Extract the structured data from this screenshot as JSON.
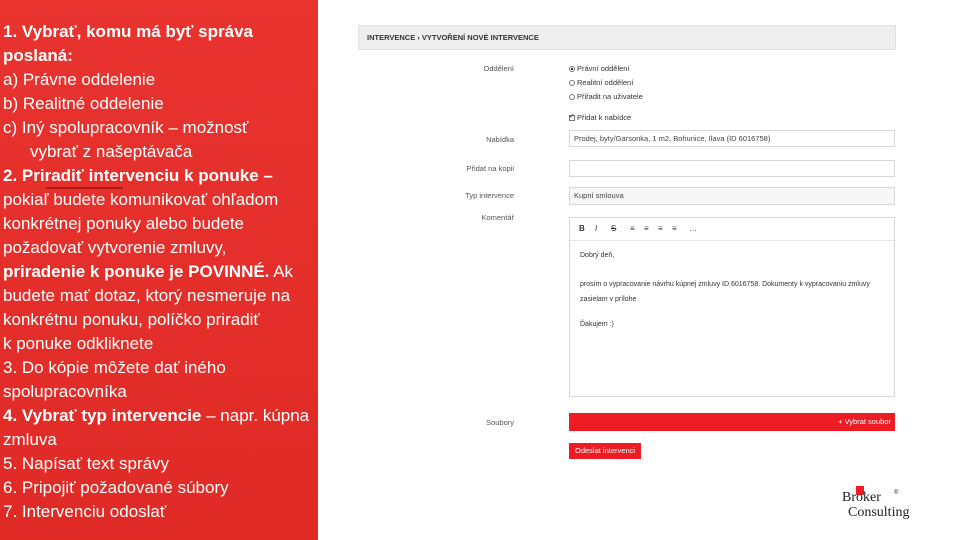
{
  "instructions": {
    "lines": [
      "1. Vybrať, komu má byť správa",
      "poslaná:",
      "a)  Právne oddelenie",
      "b)  Realitné oddelenie",
      "c)  Iný spolupracovník – možnosť",
      "vybrať z našeptávača",
      "2. Priradiť intervenciu k ponuke –",
      "pokiaľ budete komunikovať ohľadom",
      "konkrétnej ponuky alebo budete",
      "požadovať vytvorenie zmluvy,",
      "priradenie k ponuke je POVINNÉ.",
      "Ak",
      "budete mať dotaz, ktorý nesmeruje na",
      "konkrétnu ponuku, políčko priradiť",
      "k ponuke odkliknete",
      "3. Do kópie môžete dať iného",
      "spolupracovníka",
      "4. Vybrať typ intervencie",
      "– napr. kúpna",
      "zmluva",
      "5. Napísať text správy",
      "6. Pripojiť požadované súbory",
      "7. Intervenciu odoslať"
    ]
  },
  "form": {
    "breadcrumb": "INTERVENCE › VYTVOŘENÍ NOVÉ INTERVENCE",
    "labels": {
      "oddeleni": "Oddělení",
      "nabidka": "Nabídka",
      "kopie": "Přidat na kopii",
      "typ": "Typ intervence",
      "komentar": "Komentář",
      "soubory": "Soubory"
    },
    "radios": [
      "Právní oddělení",
      "Realitní oddělení",
      "Přiřadit na uživatele"
    ],
    "selected_radio": 0,
    "checkbox_label": "Přidat k nabídce",
    "nabidka_value": "Prodej, byty/Garsonka, 1 m2, Bohunice, Ilava (ID 6016758)",
    "kopie_value": "",
    "typ_value": "Kupní smlouva",
    "toolbar": [
      "B",
      "I",
      "S",
      "≡",
      "≡",
      "≡",
      "≡",
      "…"
    ],
    "comment_lines": [
      "Dobrý deň,",
      "prosím o vypracovanie návrhu kúpnej zmluvy ID 6016758. Dokumenty k vypracovaniu zmluvy",
      "zasielam v prílohe",
      "Ďakujem :)"
    ],
    "upload_label": "+ Vybrat soubor",
    "send_label": "Odeslat intervenci"
  },
  "logo": {
    "line1": "Broker",
    "line2": "Consulting",
    "mark": "®"
  },
  "colors": {
    "panel": "#e8332f",
    "accent": "#ee1c25"
  }
}
